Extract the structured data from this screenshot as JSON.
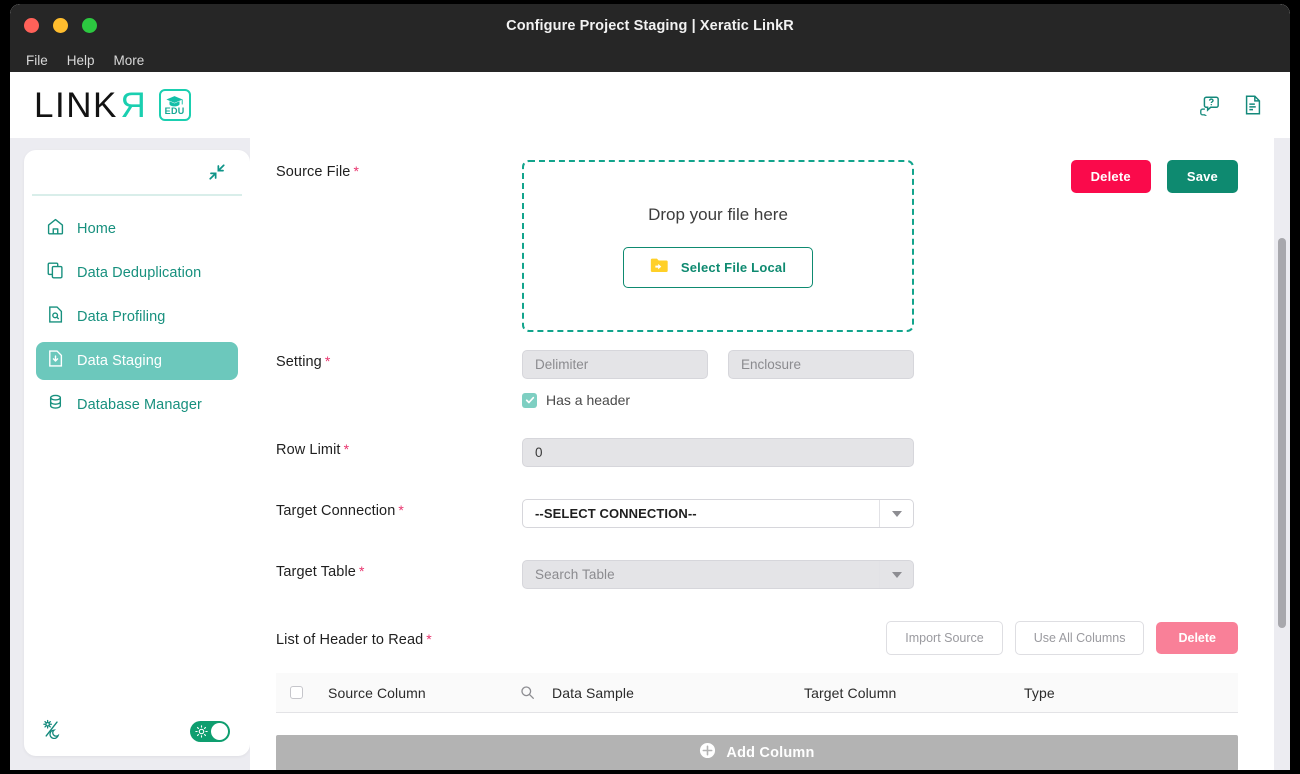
{
  "window": {
    "title": "Configure Project Staging | Xeratic LinkR",
    "menu": [
      {
        "label": "File"
      },
      {
        "label": "Help"
      },
      {
        "label": "More"
      }
    ]
  },
  "header": {
    "logo_primary": "LINK",
    "logo_accent": "R",
    "edu_badge": "EDU",
    "icons": [
      {
        "name": "help-chat-icon"
      },
      {
        "name": "document-report-icon"
      }
    ]
  },
  "sidebar": {
    "collapse_icon": "collapse-arrows-icon",
    "items": [
      {
        "label": "Home",
        "icon": "home-icon",
        "active": false
      },
      {
        "label": "Data Deduplication",
        "icon": "copy-icon",
        "active": false
      },
      {
        "label": "Data Profiling",
        "icon": "file-search-icon",
        "active": false
      },
      {
        "label": "Data Staging",
        "icon": "file-import-icon",
        "active": true
      },
      {
        "label": "Database Manager",
        "icon": "database-icon",
        "active": false
      }
    ],
    "theme_toggle": {
      "icon": "theme-day-night-icon",
      "state": "on"
    }
  },
  "main": {
    "top_actions": {
      "delete_label": "Delete",
      "save_label": "Save"
    },
    "source_file": {
      "label": "Source File",
      "required": true,
      "dropzone_text": "Drop your file here",
      "select_button": "Select File Local"
    },
    "setting": {
      "label": "Setting",
      "required": true,
      "delimiter_placeholder": "Delimiter",
      "delimiter_value": "",
      "enclosure_placeholder": "Enclosure",
      "enclosure_value": "",
      "has_header_label": "Has a header",
      "has_header_checked": true
    },
    "row_limit": {
      "label": "Row Limit",
      "required": true,
      "value": "0"
    },
    "target_connection": {
      "label": "Target Connection",
      "required": true,
      "value": "--SELECT CONNECTION--"
    },
    "target_table": {
      "label": "Target Table",
      "required": true,
      "placeholder": "Search Table"
    },
    "header_list": {
      "label": "List of Header to Read",
      "required": true,
      "import_source_label": "Import Source",
      "use_all_columns_label": "Use All Columns",
      "delete_label": "Delete"
    },
    "table": {
      "columns": [
        "Source Column",
        "Data Sample",
        "Target Column",
        "Type"
      ],
      "rows": [],
      "add_column_label": "Add Column"
    }
  },
  "colors": {
    "accent_teal": "#0E8A70",
    "accent_mint": "#1ACFB0",
    "active_item": "#6CC8BC",
    "danger": "#FA0A4B",
    "danger_soft": "#F98098",
    "required_star": "#E8336D",
    "toggle_on": "#0E9E6F",
    "page_bg": "#ECECF1"
  }
}
